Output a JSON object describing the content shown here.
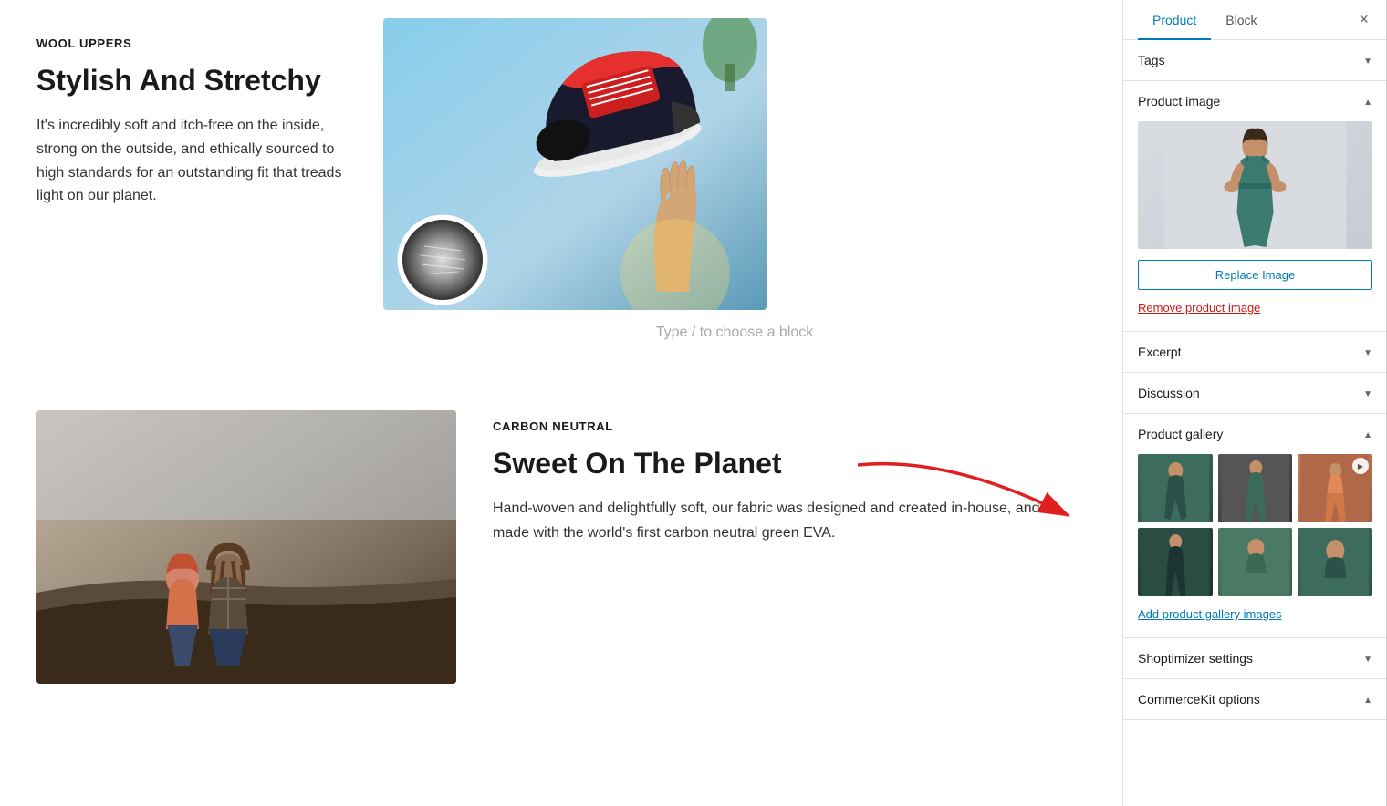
{
  "sidebar": {
    "tabs": [
      {
        "label": "Product",
        "id": "product",
        "active": true
      },
      {
        "label": "Block",
        "id": "block",
        "active": false
      }
    ],
    "close_label": "×",
    "sections": {
      "tags": {
        "label": "Tags",
        "collapsed": true
      },
      "product_image": {
        "label": "Product image",
        "collapsed": false,
        "replace_button": "Replace Image",
        "remove_link": "Remove product image"
      },
      "excerpt": {
        "label": "Excerpt",
        "collapsed": true
      },
      "discussion": {
        "label": "Discussion",
        "collapsed": true
      },
      "product_gallery": {
        "label": "Product gallery",
        "collapsed": false,
        "add_link": "Add product gallery images"
      },
      "shoptimizer": {
        "label": "Shoptimizer settings",
        "collapsed": true
      },
      "commercekit": {
        "label": "CommerceKit options",
        "collapsed": false
      }
    }
  },
  "main": {
    "section1": {
      "label": "WOOL UPPERS",
      "heading": "Stylish And Stretchy",
      "body": "It's incredibly soft and itch-free on the inside, strong on the outside, and ethically sourced to high standards for an outstanding fit that treads light on our planet."
    },
    "type_hint": "Type / to choose a block",
    "section2": {
      "label": "CARBON NEUTRAL",
      "heading": "Sweet On The Planet",
      "body": "Hand-woven and delightfully soft, our fabric was designed and created in-house, and is made with the world's first carbon neutral green EVA."
    }
  }
}
